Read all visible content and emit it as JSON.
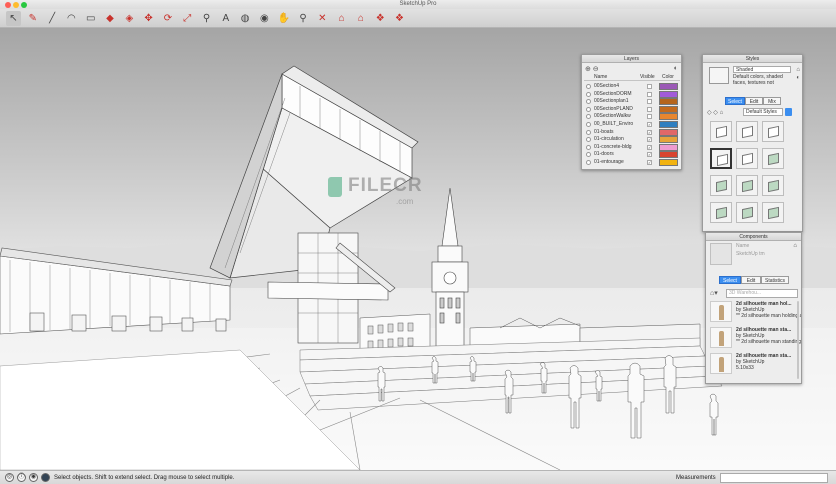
{
  "window": {
    "title": "SketchUp Pro"
  },
  "toolbar": {
    "tools": [
      {
        "name": "select-tool-icon",
        "glyph": "↖",
        "selected": true
      },
      {
        "name": "eraser-tool-icon",
        "glyph": "✎",
        "red": true
      },
      {
        "name": "line-tool-icon",
        "glyph": "╱"
      },
      {
        "name": "arc-tool-icon",
        "glyph": "◠"
      },
      {
        "name": "shape-tool-icon",
        "glyph": "▭"
      },
      {
        "name": "push-pull-tool-icon",
        "glyph": "◆",
        "red": true
      },
      {
        "name": "offset-tool-icon",
        "glyph": "◈",
        "red": true
      },
      {
        "name": "move-tool-icon",
        "glyph": "✥",
        "red": true
      },
      {
        "name": "rotate-tool-icon",
        "glyph": "⟳",
        "red": true
      },
      {
        "name": "scale-tool-icon",
        "glyph": "⤢",
        "red": true
      },
      {
        "name": "tape-measure-tool-icon",
        "glyph": "⚲"
      },
      {
        "name": "text-tool-icon",
        "glyph": "A"
      },
      {
        "name": "paint-bucket-tool-icon",
        "glyph": "◍"
      },
      {
        "name": "orbit-tool-icon",
        "glyph": "◉"
      },
      {
        "name": "pan-tool-icon",
        "glyph": "✋"
      },
      {
        "name": "zoom-tool-icon",
        "glyph": "⚲"
      },
      {
        "name": "zoom-extents-tool-icon",
        "glyph": "✕",
        "red": true
      },
      {
        "name": "warehouse-icon",
        "glyph": "⌂",
        "red": true
      },
      {
        "name": "extension-warehouse-icon",
        "glyph": "⌂",
        "red": true
      },
      {
        "name": "send-to-layout-icon",
        "glyph": "❖",
        "red": true
      },
      {
        "name": "extension-manager-icon",
        "glyph": "❖",
        "red": true
      }
    ]
  },
  "watermark": {
    "name": "FILECR",
    "sub": ".com"
  },
  "layers": {
    "title": "Layers",
    "headers": {
      "name": "Name",
      "visible": "Visible",
      "color": "Color"
    },
    "rows": [
      {
        "name": "00Section4",
        "visible": false,
        "color": "#9b59b6"
      },
      {
        "name": "00SectionDORM",
        "visible": false,
        "color": "#a25bd9"
      },
      {
        "name": "00Sectionplan1",
        "visible": false,
        "color": "#b5651d"
      },
      {
        "name": "00SectionPLAND",
        "visible": false,
        "color": "#c46a1c"
      },
      {
        "name": "00SectionWalkw",
        "visible": false,
        "color": "#e8862e"
      },
      {
        "name": "00_BUILT_Enviro",
        "visible": true,
        "color": "#2f7fc0"
      },
      {
        "name": "01-boats",
        "visible": true,
        "color": "#e06868"
      },
      {
        "name": "01-circulation",
        "visible": true,
        "color": "#e6a33a"
      },
      {
        "name": "01-concrete-bldg",
        "visible": true,
        "color": "#ee9bd0"
      },
      {
        "name": "01-doors",
        "visible": true,
        "color": "#d9442f"
      },
      {
        "name": "01-entourage",
        "visible": true,
        "color": "#f2b311"
      }
    ]
  },
  "styles": {
    "title": "Styles",
    "current_name": "Shaded",
    "current_desc": "Default colors, shaded faces, textures not",
    "tabs": [
      "Select",
      "Edit",
      "Mix"
    ],
    "active_tab": "Select",
    "collection": "Default Styles"
  },
  "components": {
    "title": "Components",
    "name_placeholder": "Name",
    "desc_placeholder": "SketchUp tm",
    "tabs": [
      "Select",
      "Edit",
      "Statistics"
    ],
    "active_tab": "Select",
    "search_placeholder": "3D Warehou...",
    "results": [
      {
        "title": "2d silhouette man hol...",
        "by": "by SketchUp",
        "info": "** 2d silhouette man holding a ball ** (http:..."
      },
      {
        "title": "2d silhouette man sta...",
        "by": "by SketchUp",
        "info": "** 2d silhouette man standing ** (http://www...."
      },
      {
        "title": "2d silhouette man sta...",
        "by": "by SketchUp",
        "info": "5.10x33"
      }
    ]
  },
  "status": {
    "text": "Select objects. Shift to extend select. Drag mouse to select multiple.",
    "measurements_label": "Measurements"
  }
}
